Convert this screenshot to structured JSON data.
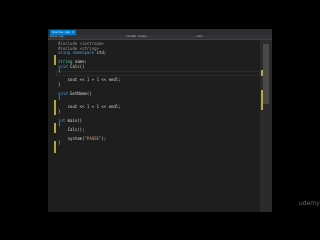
{
  "tab": {
    "title": "Source.cpp ✕"
  },
  "navbar": {
    "scope": "(Global Scope)",
    "left_label": "Calls.cpp",
    "right_label": "✓ Calc"
  },
  "code": {
    "lines": [
      {
        "id": "l1",
        "html": "<span class='pp'>#include &lt;iostream&gt;</span>"
      },
      {
        "id": "l2",
        "html": "<span class='pp'>#include &lt;string&gt;</span>"
      },
      {
        "id": "l3",
        "html": "<span class='kw'>using namespace</span> std;"
      },
      {
        "id": "l4",
        "html": ""
      },
      {
        "id": "l5",
        "html": "<span class='ty'>string</span> name;"
      },
      {
        "id": "l6",
        "html": "<span class='kw'>void</span> Calc()"
      },
      {
        "id": "l7",
        "html": "{"
      },
      {
        "id": "l8",
        "html": ""
      },
      {
        "id": "l9",
        "html": "    cout &lt;&lt; <span class='num'>1</span> + <span class='num'>1</span> &lt;&lt; endl;"
      },
      {
        "id": "l10",
        "html": "}"
      },
      {
        "id": "l11",
        "html": ""
      },
      {
        "id": "l12",
        "html": "<span class='kw'>void</span> GetName()"
      },
      {
        "id": "l13",
        "html": "{"
      },
      {
        "id": "l14",
        "html": ""
      },
      {
        "id": "l15",
        "html": "    cout &lt;&lt; <span class='num'>1</span> + <span class='num'>1</span> &lt;&lt; endl;"
      },
      {
        "id": "l16",
        "html": "}"
      },
      {
        "id": "l17",
        "html": ""
      },
      {
        "id": "l18",
        "html": "<span class='kw'>int</span> main()"
      },
      {
        "id": "l19",
        "html": "{"
      },
      {
        "id": "l20",
        "html": "    Calc();"
      },
      {
        "id": "l21",
        "html": ""
      },
      {
        "id": "l22",
        "html": "    system(<span class='str'>\"PAUSE\"</span>);"
      },
      {
        "id": "l23",
        "html": "}"
      }
    ]
  },
  "watermark": "udemy"
}
